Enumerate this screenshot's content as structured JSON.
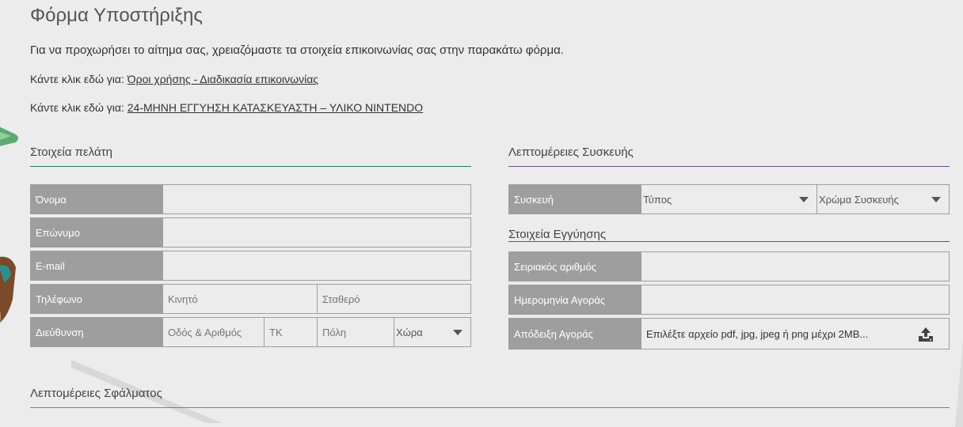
{
  "page": {
    "title": "Φόρμα Υποστήριξης",
    "intro": "Για να προχωρήσει το αίτημα σας, χρειαζόμαστε τα στοιχεία επικοινωνίας σας στην παρακάτω φόρμα.",
    "click_prefix": "Κάντε κλικ εδώ για:",
    "link_terms": "Όροι χρήσης - Διαδικασία επικοινωνίας",
    "link_warranty": "24-ΜΗΝΗ ΕΓΓΥΗΣΗ ΚΑΤΑΣΚΕΥΑΣΤΗ – ΥΛΙΚΟ NINTENDO"
  },
  "customer": {
    "section_title": "Στοιχεία πελάτη",
    "name_label": "Όνομα",
    "surname_label": "Επώνυμο",
    "email_label": "E-mail",
    "phone_label": "Τηλέφωνο",
    "mobile_placeholder": "Κινητό",
    "landline_placeholder": "Σταθερό",
    "address_label": "Διεύθυνση",
    "street_placeholder": "Οδός & Αριθμός",
    "zip_placeholder": "ΤΚ",
    "city_placeholder": "Πόλη",
    "country_select": "Χώρα"
  },
  "device": {
    "section_title": "Λεπτομέρειες Συσκευής",
    "device_label": "Συσκευή",
    "type_select": "Τύπος",
    "color_select": "Χρώμα Συσκευής"
  },
  "warranty": {
    "section_title": "Στοιχεία Εγγύησης",
    "serial_label": "Σειριακός αριθμός",
    "purchase_date_label": "Ημερομηνία Αγοράς",
    "receipt_label": "Απόδειξη Αγοράς",
    "receipt_hint": "Επιλέξτε αρχείο pdf, jpg, jpeg ή png μέχρι 2MB..."
  },
  "fault": {
    "section_title": "Λεπτομέρειες Σφάλματος"
  },
  "colors": {
    "customer_line": "#2e7d4f",
    "device_line": "#6a4a8c",
    "warranty_line": "#2e6e5a",
    "fault_line": "#d2691e",
    "label_bg": "#9e9e9e"
  }
}
